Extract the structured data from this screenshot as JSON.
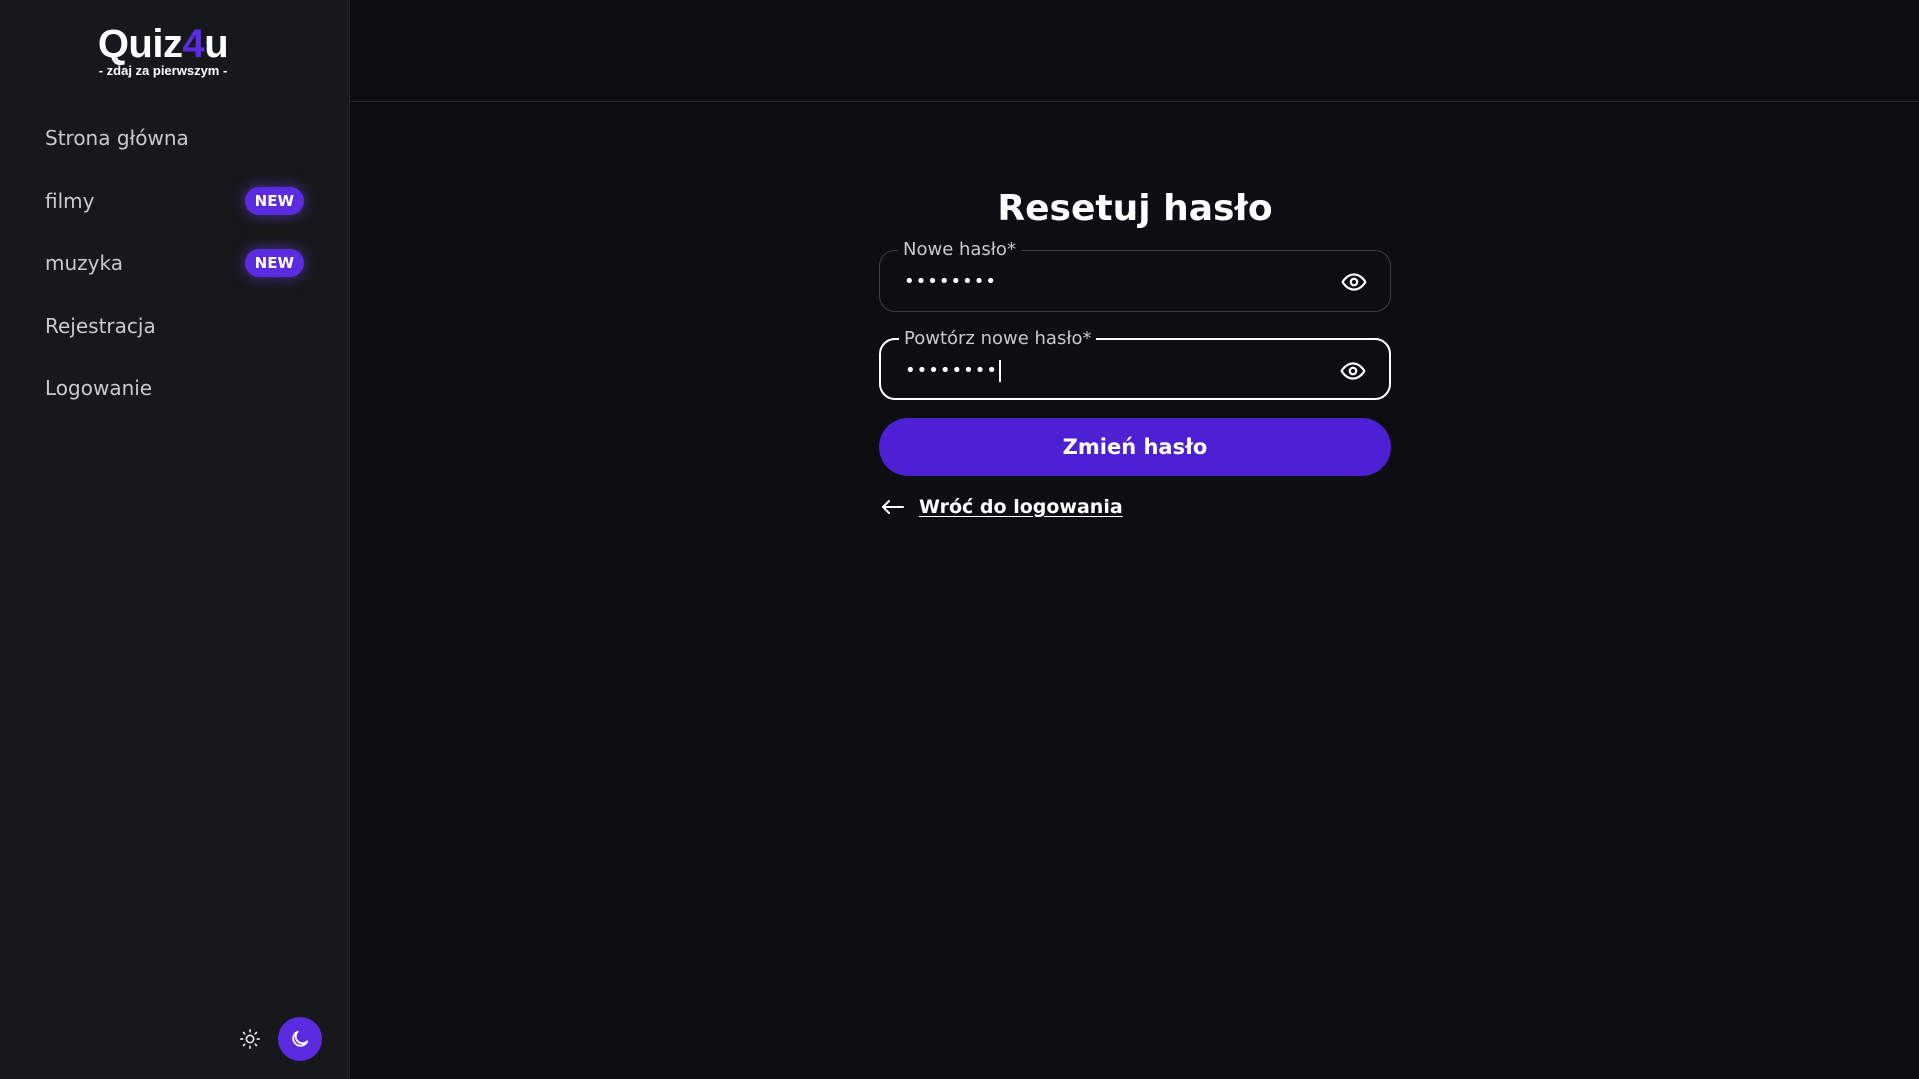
{
  "brand": {
    "title_prefix": "Quiz",
    "title_accent": "4",
    "title_suffix": "u",
    "tagline": "- zdaj za pierwszym -"
  },
  "sidebar": {
    "items": [
      {
        "label": "Strona główna",
        "badge": ""
      },
      {
        "label": "filmy",
        "badge": "NEW"
      },
      {
        "label": "muzyka",
        "badge": "NEW"
      },
      {
        "label": "Rejestracja",
        "badge": ""
      },
      {
        "label": "Logowanie",
        "badge": ""
      }
    ],
    "theme": {
      "light_icon": "sun-icon",
      "dark_icon": "moon-icon",
      "active": "dark"
    }
  },
  "form": {
    "title": "Resetuj hasło",
    "new_password": {
      "label": "Nowe hasło*",
      "value": "••••••••",
      "icon": "eye-icon"
    },
    "repeat_password": {
      "label": "Powtórz nowe hasło*",
      "value": "••••••••",
      "icon": "eye-icon"
    },
    "submit_label": "Zmień hasło",
    "back_label": "Wróć do logowania",
    "back_icon": "arrow-left-icon"
  },
  "colors": {
    "accent": "#5b2be0",
    "button": "#4e20d4",
    "background": "#0d0e11",
    "sidebar": "#17181c"
  }
}
